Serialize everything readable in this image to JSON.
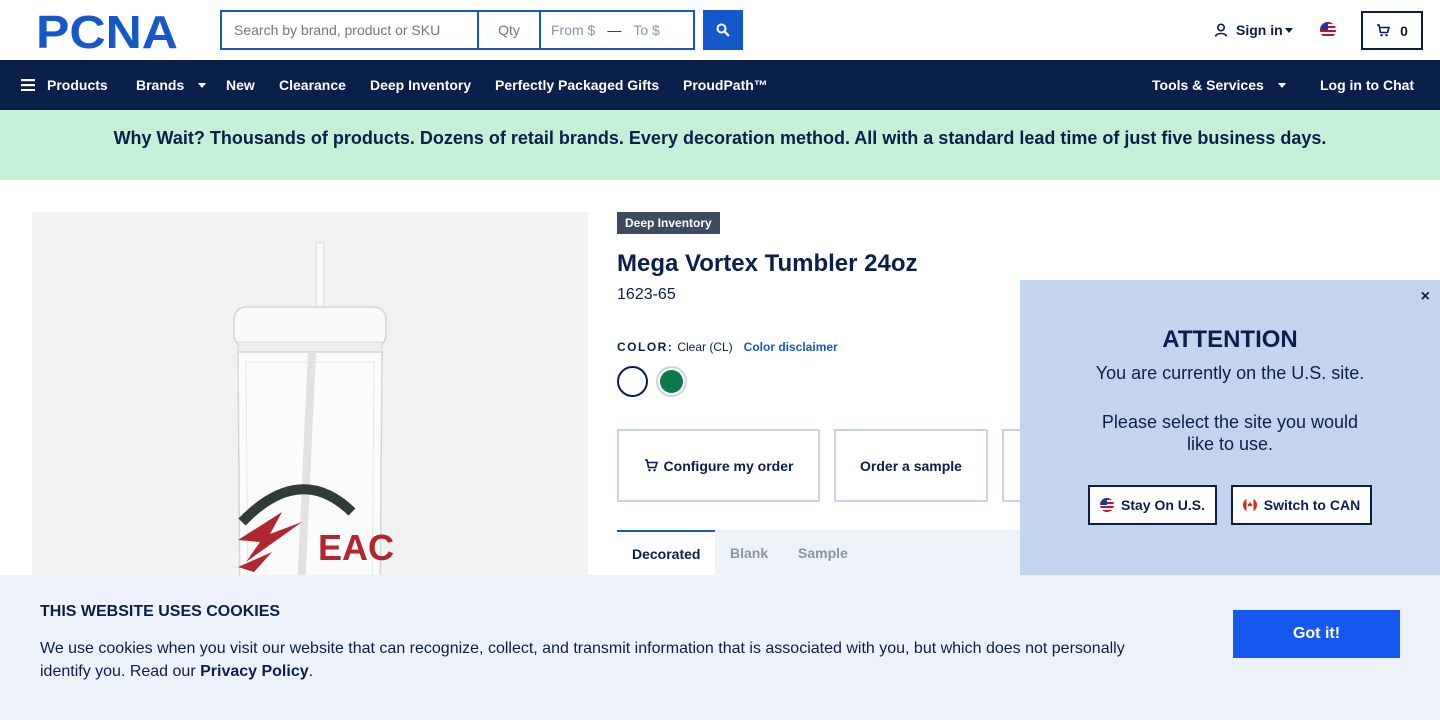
{
  "header": {
    "logo_text": "PCNA",
    "search": {
      "placeholder": "Search by brand, product or SKU"
    },
    "qty": {
      "placeholder": "Qty"
    },
    "price": {
      "from_placeholder": "From $",
      "to_placeholder": "To $"
    },
    "signin_label": "Sign in",
    "cart_count": "0",
    "icons": {
      "search": "search-icon",
      "user": "user-icon",
      "flag": "us-flag-icon",
      "cart": "cart-icon"
    }
  },
  "nav": {
    "items": [
      {
        "label": "Products"
      },
      {
        "label": "Brands"
      },
      {
        "label": "New"
      },
      {
        "label": "Clearance"
      },
      {
        "label": "Deep Inventory"
      },
      {
        "label": "Perfectly Packaged Gifts"
      },
      {
        "label": "ProudPath™"
      }
    ],
    "tools_label": "Tools & Services",
    "chat_label": "Log in to Chat"
  },
  "promo": {
    "text": "Why Wait? Thousands of products. Dozens of retail brands. Every decoration method. All with a standard lead time of just five business days."
  },
  "product": {
    "badge": "Deep Inventory",
    "title": "Mega Vortex Tumbler 24oz",
    "sku": "1623-65",
    "color_label": "COLOR:",
    "color_value": "Clear (CL)",
    "color_disclaimer": "Color disclaimer",
    "image_logo_text": "EAC",
    "actions": {
      "configure": "Configure my order",
      "sample": "Order a sample"
    },
    "tabs": [
      "Decorated",
      "Blank",
      "Sample"
    ]
  },
  "site_modal": {
    "heading": "ATTENTION",
    "line1": "You are currently on the U.S. site.",
    "line2": "Please select the site you would",
    "line3": "like to use.",
    "stay_label": "Stay On U.S.",
    "switch_label": "Switch to CAN",
    "close_symbol": "×"
  },
  "cookies": {
    "title": "THIS WEBSITE USES COOKIES",
    "text_before": "We use cookies when you visit our website that can recognize, collect, and transmit information that is associated with you, but which does not personally identify you. Read our ",
    "link_label": "Privacy Policy",
    "text_after": ".",
    "button_label": "Got it!"
  },
  "colors": {
    "navy": "#0b1f4b",
    "accent_blue": "#1458c9",
    "promo_bg": "#c5efd6",
    "modal_bg": "#c3d5ec",
    "swatch_green": "#0b7a4b"
  }
}
